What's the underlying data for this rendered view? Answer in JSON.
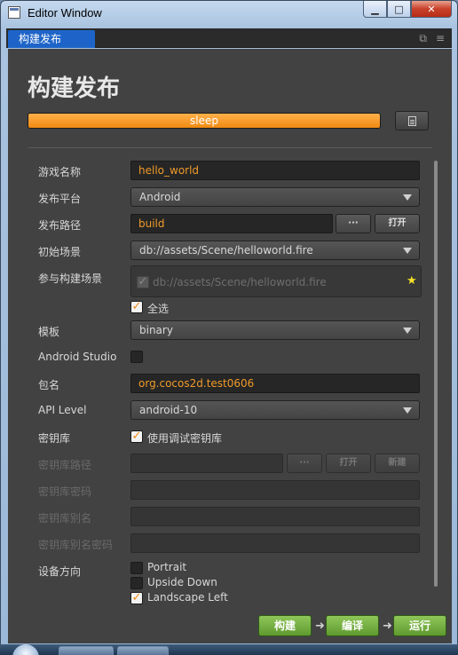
{
  "window": {
    "title": "Editor Window",
    "controls": {
      "minimize": "▁",
      "maximize": "□",
      "close": "✕"
    }
  },
  "tab": {
    "label": "构建发布"
  },
  "tab_tools": {
    "popout": "⧉",
    "menu": "≡"
  },
  "page": {
    "title": "构建发布"
  },
  "progress": {
    "status": "sleep",
    "fraction": 1.0
  },
  "form": {
    "game_name": {
      "label": "游戏名称",
      "value": "hello_world"
    },
    "platform": {
      "label": "发布平台",
      "value": "Android"
    },
    "build_path": {
      "label": "发布路径",
      "value": "build",
      "browse": "···",
      "open": "打开"
    },
    "start_scene": {
      "label": "初始场景",
      "value": "db://assets/Scene/helloworld.fire"
    },
    "build_scenes": {
      "label": "参与构建场景",
      "item": "db://assets/Scene/helloworld.fire",
      "select_all": "全选"
    },
    "template": {
      "label": "模板",
      "value": "binary"
    },
    "android_studio": {
      "label": "Android Studio"
    },
    "package_name": {
      "label": "包名",
      "value": "org.cocos2d.test0606"
    },
    "api_level": {
      "label": "API Level",
      "value": "android-10"
    },
    "keystore": {
      "label": "密钥库",
      "option": "使用调试密钥库"
    },
    "keystore_path": {
      "label": "密钥库路径",
      "browse": "···",
      "open": "打开",
      "create": "新建"
    },
    "keystore_password": {
      "label": "密钥库密码"
    },
    "keystore_alias": {
      "label": "密钥库别名"
    },
    "keystore_alias_password": {
      "label": "密钥库别名密码"
    },
    "orientation": {
      "label": "设备方向",
      "options": [
        "Portrait",
        "Upside Down",
        "Landscape Left"
      ]
    }
  },
  "actions": {
    "build": "构建",
    "compile": "编译",
    "run": "运行",
    "arrow": "➜"
  },
  "colors": {
    "accent_orange": "#f08a12",
    "panel_bg": "#424242",
    "tab_blue": "#1e64c8",
    "action_green": "#6fae3c"
  }
}
